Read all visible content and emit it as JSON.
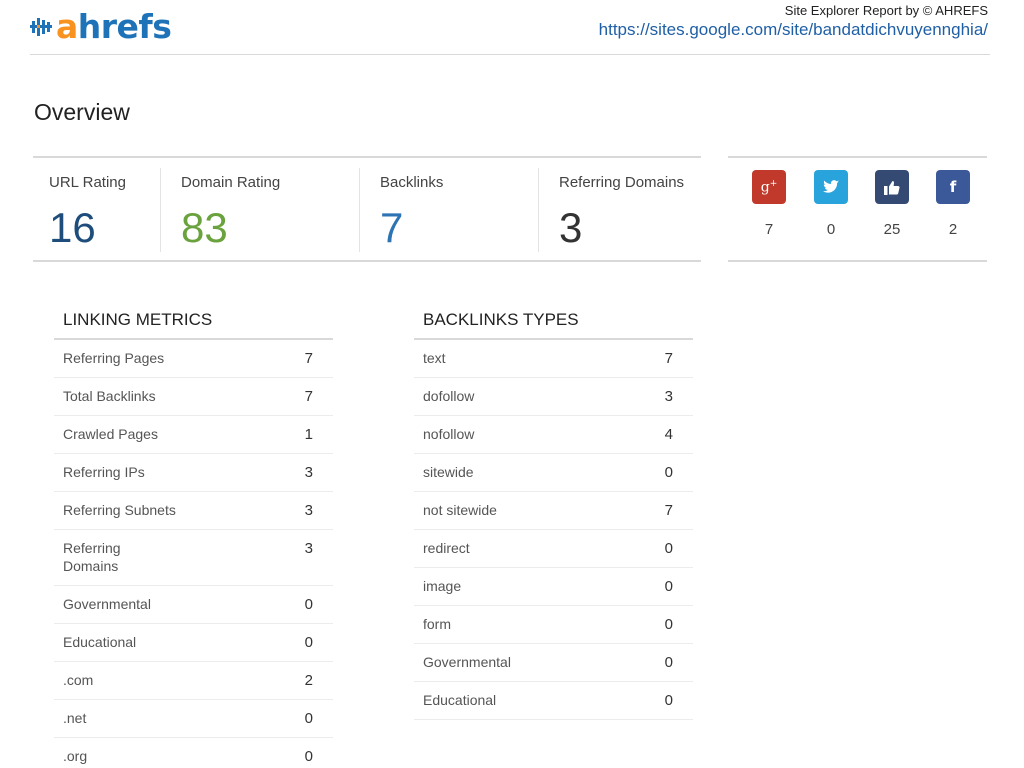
{
  "header": {
    "logo_text_a": "a",
    "logo_text_rest": "hrefs",
    "report_by": "Site Explorer Report by © AHREFS",
    "target_url": "https://sites.google.com/site/bandatdichvuyennghia/"
  },
  "overview": {
    "title": "Overview",
    "metrics": [
      {
        "label": "URL Rating",
        "value": "16",
        "color": "#1e4d7b"
      },
      {
        "label": "Domain Rating",
        "value": "83",
        "color": "#6aa23e"
      },
      {
        "label": "Backlinks",
        "value": "7",
        "color": "#2e74b5"
      },
      {
        "label": "Referring Domains",
        "value": "3",
        "color": "#333333"
      }
    ],
    "social": [
      {
        "icon": "google-plus-icon",
        "glyph": "g+",
        "count": "7",
        "color": "#c0392b"
      },
      {
        "icon": "twitter-icon",
        "glyph": "t",
        "count": "0",
        "color": "#29a3dc"
      },
      {
        "icon": "like-icon",
        "glyph": "like",
        "count": "25",
        "color": "#354a72"
      },
      {
        "icon": "facebook-icon",
        "glyph": "f",
        "count": "2",
        "color": "#3b5998"
      }
    ]
  },
  "linking_metrics": {
    "title": "LINKING METRICS",
    "rows": [
      {
        "label": "Referring Pages",
        "value": "7"
      },
      {
        "label": "Total Backlinks",
        "value": "7"
      },
      {
        "label": "Crawled Pages",
        "value": "1"
      },
      {
        "label": "Referring IPs",
        "value": "3"
      },
      {
        "label": "Referring Subnets",
        "value": "3"
      },
      {
        "label": "Referring\nDomains",
        "value": "3"
      },
      {
        "label": "Governmental",
        "value": "0"
      },
      {
        "label": "Educational",
        "value": "0"
      },
      {
        "label": ".com",
        "value": "2"
      },
      {
        "label": ".net",
        "value": "0"
      },
      {
        "label": ".org",
        "value": "0"
      }
    ]
  },
  "backlinks_types": {
    "title": "BACKLINKS TYPES",
    "rows": [
      {
        "label": "text",
        "value": "7"
      },
      {
        "label": "dofollow",
        "value": "3"
      },
      {
        "label": "nofollow",
        "value": "4"
      },
      {
        "label": "sitewide",
        "value": "0"
      },
      {
        "label": "not sitewide",
        "value": "7"
      },
      {
        "label": "redirect",
        "value": "0"
      },
      {
        "label": "image",
        "value": "0"
      },
      {
        "label": "form",
        "value": "0"
      },
      {
        "label": "Governmental",
        "value": "0"
      },
      {
        "label": "Educational",
        "value": "0"
      }
    ]
  }
}
